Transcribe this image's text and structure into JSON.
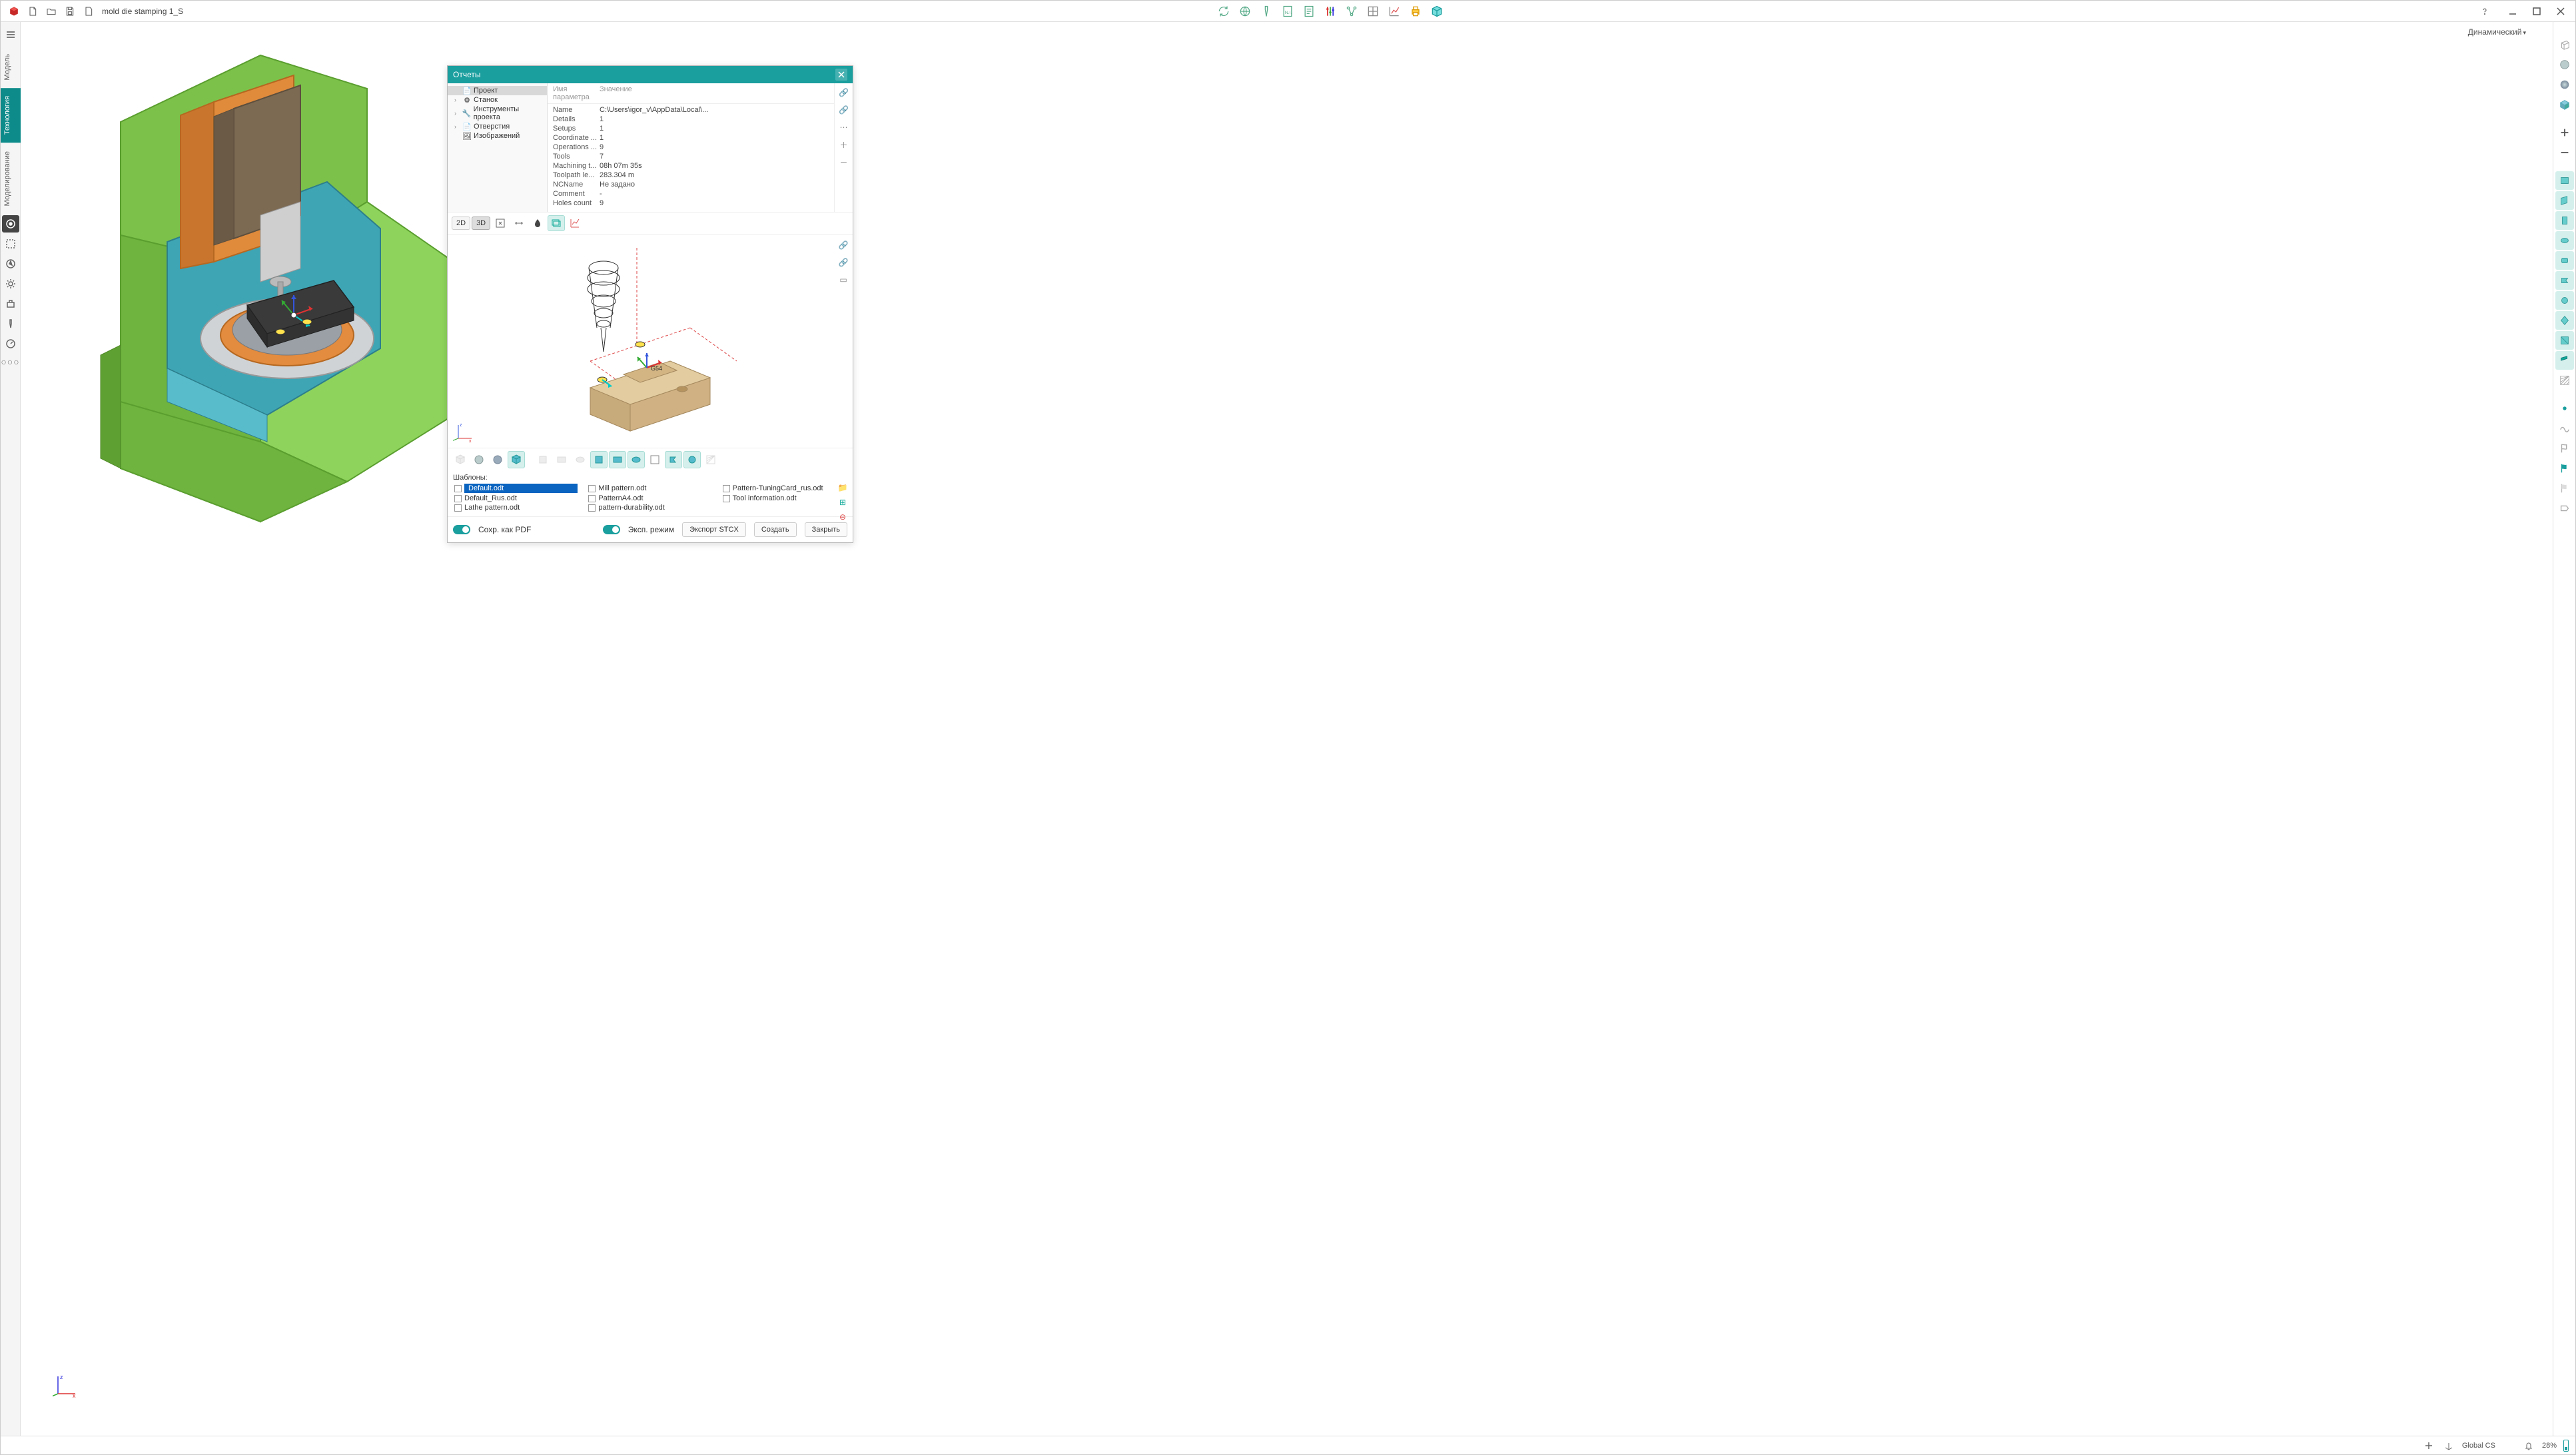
{
  "title": "mold die stamping 1_S",
  "viewport": {
    "mode_label": "Динамический"
  },
  "left_tabs": [
    "Модель",
    "Технология",
    "Моделирование"
  ],
  "left_tabs_active": 1,
  "reports": {
    "title": "Отчеты",
    "tree": [
      {
        "label": "Проект",
        "selected": true,
        "icon": "file"
      },
      {
        "label": "Станок",
        "icon": "gear"
      },
      {
        "label": "Инструменты проекта",
        "icon": "tool"
      },
      {
        "label": "Отверстия",
        "icon": "file"
      },
      {
        "label": "Изображений",
        "icon": "image",
        "leaf": true
      }
    ],
    "props_header": {
      "name": "Имя параметра",
      "value": "Значение"
    },
    "props": [
      {
        "k": "Name",
        "v": "C:\\Users\\igor_v\\AppData\\Local\\..."
      },
      {
        "k": "Details",
        "v": "1"
      },
      {
        "k": "Setups",
        "v": "1"
      },
      {
        "k": "Coordinate ...",
        "v": "1"
      },
      {
        "k": "Operations ...",
        "v": "9"
      },
      {
        "k": "Tools",
        "v": "7"
      },
      {
        "k": "Machining t...",
        "v": "08h 07m 35s"
      },
      {
        "k": "Toolpath le...",
        "v": "283.304 m"
      },
      {
        "k": "NCName",
        "v": "Не задано"
      },
      {
        "k": "Comment",
        "v": "-"
      },
      {
        "k": "Holes count",
        "v": "9"
      }
    ],
    "view_buttons": {
      "b2d": "2D",
      "b3d": "3D"
    },
    "cs_label": "G54",
    "templates_label": "Шаблоны:",
    "templates": [
      {
        "label": "Default.odt",
        "selected": true
      },
      {
        "label": "Mill pattern.odt"
      },
      {
        "label": "Pattern-TuningCard_rus.odt"
      },
      {
        "label": "Default_Rus.odt"
      },
      {
        "label": "PatternA4.odt"
      },
      {
        "label": "Tool information.odt"
      },
      {
        "label": "Lathe pattern.odt"
      },
      {
        "label": "pattern-durability.odt"
      }
    ],
    "footer": {
      "save_pdf": "Сохр. как PDF",
      "exp_mode": "Эксп. режим",
      "export_stcx": "Экспорт STCX",
      "create": "Создать",
      "close": "Закрыть"
    }
  },
  "statusbar": {
    "cs": "Global CS",
    "zoom": "28%"
  }
}
